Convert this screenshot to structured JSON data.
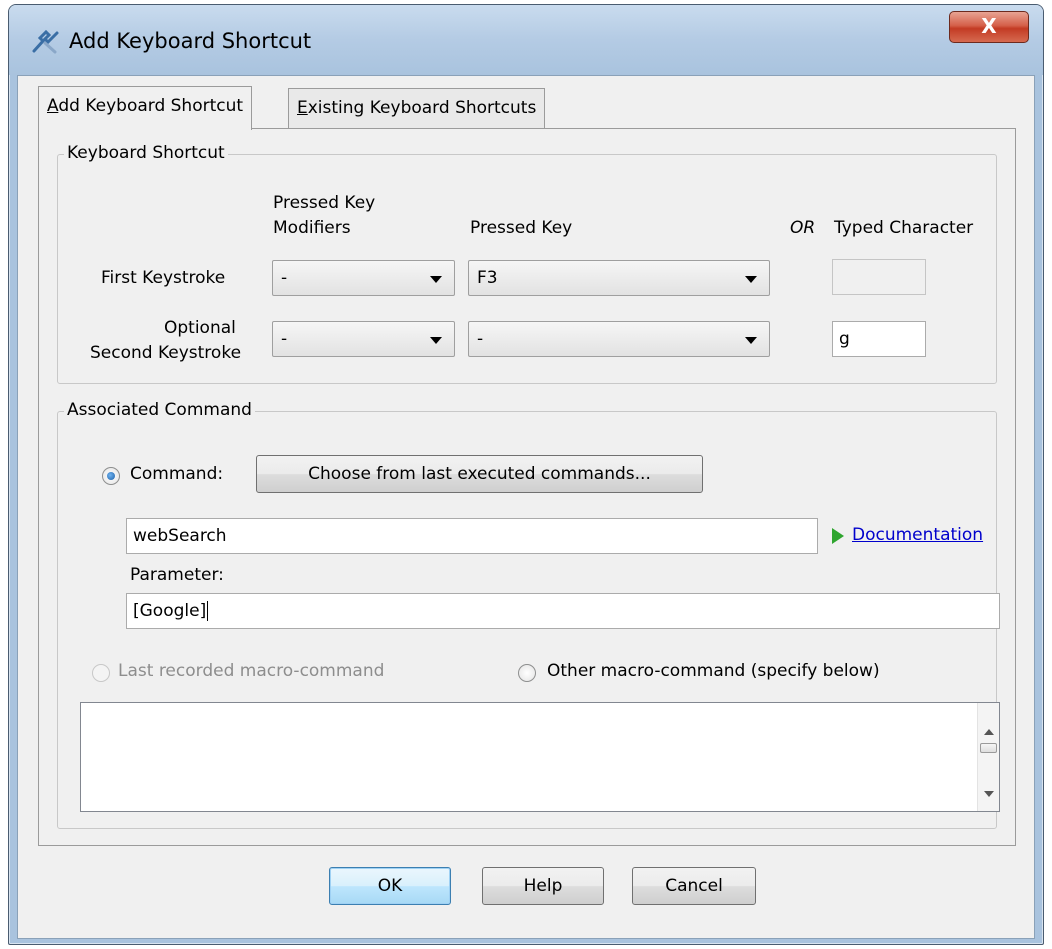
{
  "window": {
    "title": "Add Keyboard Shortcut",
    "close_label": "X"
  },
  "tabs": [
    {
      "label": "Add Keyboard Shortcut",
      "mnemonic": "A",
      "rest": "dd Keyboard Shortcut",
      "active": true
    },
    {
      "label": "Existing Keyboard Shortcuts",
      "mnemonic": "E",
      "rest": "xisting Keyboard Shortcuts",
      "active": false
    }
  ],
  "keyboard_shortcut": {
    "legend": "Keyboard Shortcut",
    "col_modifiers_line1": "Pressed Key",
    "col_modifiers_line2": "Modifiers",
    "col_key": "Pressed Key",
    "col_or": "OR",
    "col_typed": "Typed Character",
    "first_label": "First Keystroke",
    "second_label_line1": "Optional",
    "second_label_line2": "Second Keystroke",
    "first_modifiers": "-",
    "first_key": "F3",
    "first_typed": "",
    "second_modifiers": "-",
    "second_key": "-",
    "second_typed": "g"
  },
  "associated_command": {
    "legend": "Associated Command",
    "command_radio_label": "Command:",
    "choose_button": "Choose from last executed commands...",
    "command_value": "webSearch",
    "documentation_link": "Documentation",
    "parameter_label": "Parameter:",
    "parameter_value": "[Google]",
    "last_macro_label": "Last recorded macro-command",
    "other_macro_label": "Other macro-command (specify below)",
    "macro_text": ""
  },
  "buttons": {
    "ok": "OK",
    "help": "Help",
    "cancel": "Cancel"
  }
}
